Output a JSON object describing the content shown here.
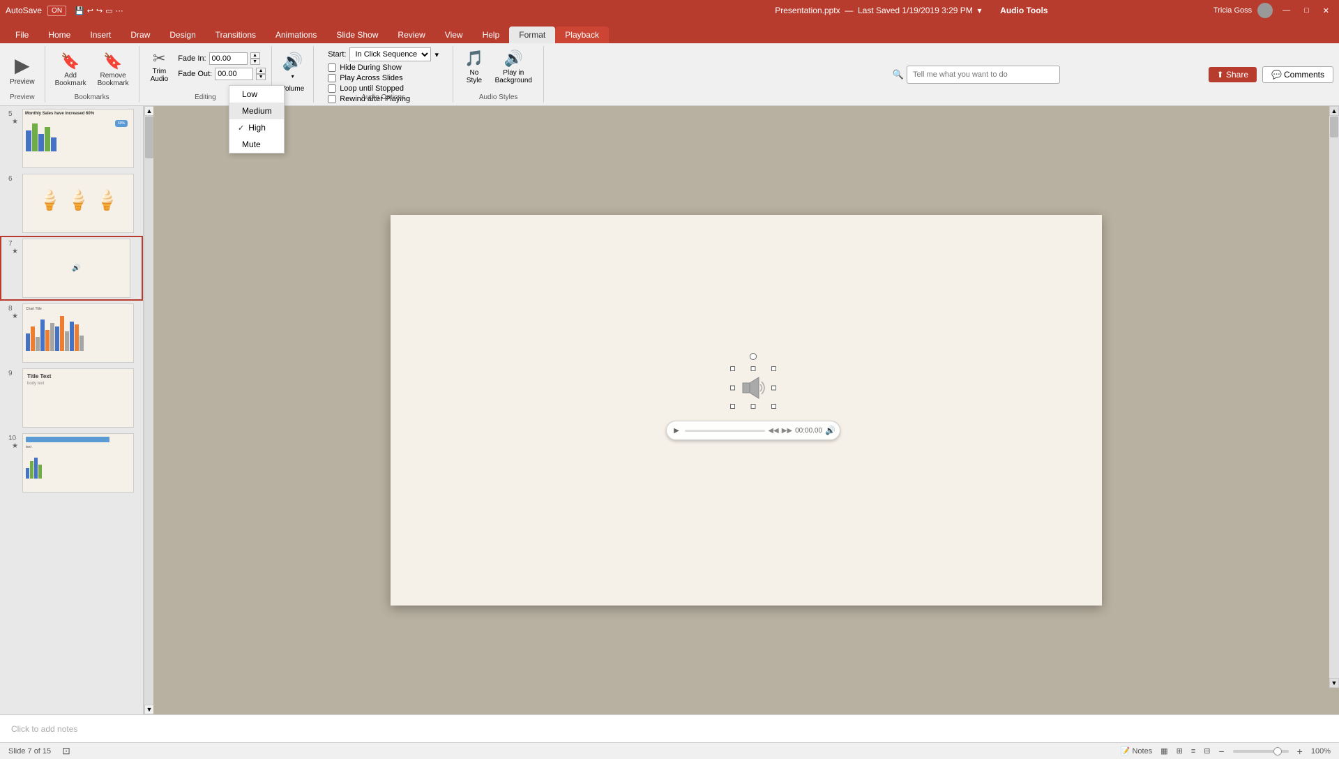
{
  "titleBar": {
    "appName": "AutoSave",
    "autoSaveOn": "ON",
    "fileName": "Presentation.pptx",
    "lastSaved": "Last Saved 1/19/2019 3:29 PM",
    "audioTools": "Audio Tools",
    "userName": "Tricia Goss",
    "winBtnMin": "—",
    "winBtnMax": "□",
    "winBtnClose": "✕"
  },
  "ribbonTabs": {
    "tabs": [
      "File",
      "Home",
      "Insert",
      "Draw",
      "Design",
      "Transitions",
      "Animations",
      "Slide Show",
      "Review",
      "View",
      "Help",
      "Format",
      "Playback"
    ]
  },
  "ribbon": {
    "previewGroup": {
      "label": "Preview",
      "previewBtn": "▶",
      "previewLabel": "Preview"
    },
    "bookmarksGroup": {
      "label": "Bookmarks",
      "addBtn": "Add\nBookmark",
      "removeBtn": "Remove\nBookmark"
    },
    "editingGroup": {
      "label": "Editing",
      "trimLabel": "Trim\nAudio",
      "fadeInLabel": "Fade In:",
      "fadeInValue": "00.00",
      "fadeOutLabel": "Fade Out:",
      "fadeOutValue": "00.00"
    },
    "volumeGroup": {
      "label": "Volume",
      "dropdown": {
        "items": [
          "Low",
          "Medium",
          "High",
          "Mute"
        ],
        "selected": "High"
      }
    },
    "audioOptionsGroup": {
      "label": "Audio Options",
      "startLabel": "Start:",
      "startValue": "In Click Sequence",
      "hideDuringShowLabel": "Hide During Show",
      "hideDuringShow": false,
      "playAcrossSlidesLabel": "Play Across Slides",
      "playAcrossSlides": false,
      "loopLabel": "Loop until Stopped",
      "loop": false,
      "rewindLabel": "Rewind after Playing",
      "rewind": false
    },
    "audioStylesGroup": {
      "label": "Audio Styles",
      "noStyleLabel": "No\nStyle",
      "playInBackgroundLabel": "Play in\nBackground"
    },
    "searchPlaceholder": "Tell me what you want to do",
    "shareLabel": "Share",
    "commentsLabel": "Comments"
  },
  "slidePanel": {
    "slides": [
      {
        "number": "5",
        "star": "*",
        "id": "slide5"
      },
      {
        "number": "6",
        "star": "",
        "id": "slide6"
      },
      {
        "number": "7",
        "star": "*",
        "id": "slide7",
        "active": true
      },
      {
        "number": "8",
        "star": "*",
        "id": "slide8"
      },
      {
        "number": "9",
        "star": "",
        "id": "slide9"
      },
      {
        "number": "10",
        "star": "*",
        "id": "slide10"
      }
    ]
  },
  "mainSlide": {
    "audioPlayer": {
      "playBtn": "▶",
      "rewindBtn": "◀◀",
      "forwardBtn": "▶▶",
      "time": "00:00.00",
      "volBtn": "🔊"
    }
  },
  "volumeDropdown": {
    "items": [
      {
        "label": "Low",
        "selected": false
      },
      {
        "label": "Medium",
        "selected": false
      },
      {
        "label": "High",
        "selected": true
      },
      {
        "label": "Mute",
        "selected": false
      }
    ]
  },
  "notesArea": {
    "placeholder": "Click to add notes"
  },
  "statusBar": {
    "slideInfo": "Slide 7 of 15",
    "accessibility": "⊡",
    "notesLabel": "Notes",
    "viewIcons": [
      "▦",
      "⊞",
      "≡",
      "⊟"
    ],
    "zoomMinus": "-",
    "zoomLevel": "100%",
    "zoomPlus": "+"
  }
}
